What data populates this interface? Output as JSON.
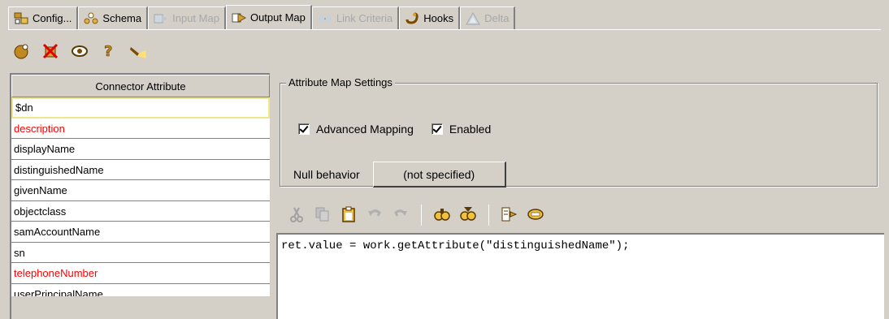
{
  "tabs": [
    {
      "label": "Config...",
      "icon": "config-icon",
      "state": "normal"
    },
    {
      "label": "Schema",
      "icon": "schema-icon",
      "state": "normal"
    },
    {
      "label": "Input Map",
      "icon": "input-map-icon",
      "state": "disabled"
    },
    {
      "label": "Output Map",
      "icon": "output-map-icon",
      "state": "active"
    },
    {
      "label": "Link Criteria",
      "icon": "link-criteria-icon",
      "state": "disabled"
    },
    {
      "label": "Hooks",
      "icon": "hooks-icon",
      "state": "normal"
    },
    {
      "label": "Delta",
      "icon": "delta-icon",
      "state": "disabled"
    }
  ],
  "toolbar": {
    "buttons": [
      "add-attribute-icon",
      "delete-attribute-icon",
      "view-icon",
      "help-icon",
      "flashlight-icon"
    ]
  },
  "attribute_panel": {
    "header": "Connector Attribute",
    "items": [
      {
        "label": "$dn",
        "color": "#000000",
        "selected": true
      },
      {
        "label": "description",
        "color": "#ff0000",
        "selected": false
      },
      {
        "label": "displayName",
        "color": "#000000",
        "selected": false
      },
      {
        "label": "distinguishedName",
        "color": "#000000",
        "selected": false
      },
      {
        "label": "givenName",
        "color": "#000000",
        "selected": false
      },
      {
        "label": "objectclass",
        "color": "#000000",
        "selected": false
      },
      {
        "label": "samAccountName",
        "color": "#000000",
        "selected": false
      },
      {
        "label": "sn",
        "color": "#000000",
        "selected": false
      },
      {
        "label": "telephoneNumber",
        "color": "#ff0000",
        "selected": false
      },
      {
        "label": "userPrincipalName",
        "color": "#000000",
        "selected": false
      }
    ]
  },
  "settings": {
    "group_title": "Attribute Map Settings",
    "advanced_mapping_label": "Advanced Mapping",
    "advanced_mapping_checked": true,
    "enabled_label": "Enabled",
    "enabled_checked": true,
    "null_behavior_label": "Null behavior",
    "null_behavior_value": "(not specified)"
  },
  "editor": {
    "toolbar": [
      "cut-icon",
      "copy-icon",
      "paste-icon",
      "undo-icon",
      "redo-icon",
      "find-icon",
      "find-next-icon",
      "insert-icon",
      "edit-icon"
    ],
    "code": "ret.value = work.getAttribute(\"distinguishedName\");"
  },
  "colors": {
    "panel_bg": "#d4d0c8",
    "highlight_red": "#ff0000",
    "selection_border": "#f0e68c"
  }
}
